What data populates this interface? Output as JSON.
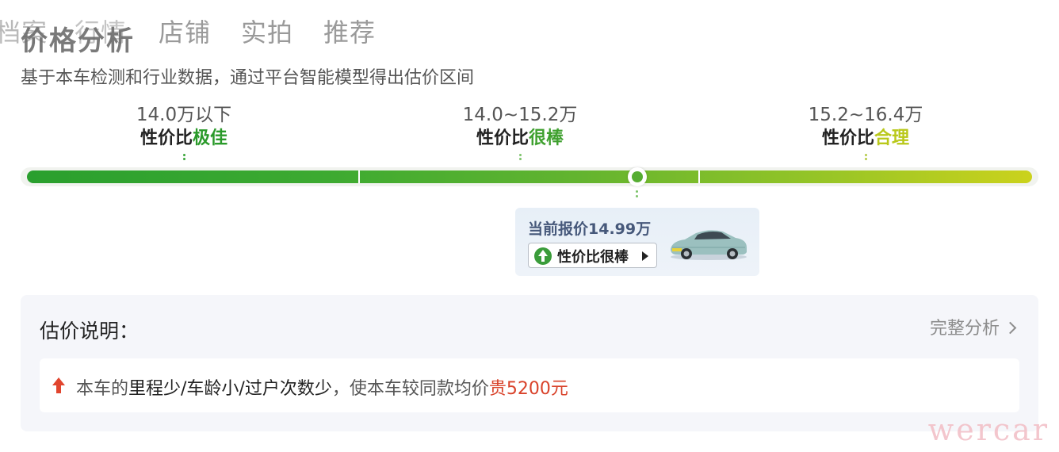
{
  "tabs": [
    "档案",
    "行情",
    "店铺",
    "实拍",
    "推荐"
  ],
  "section_title": "价格分析",
  "subtitle": "基于本车检测和行业数据，通过平台智能模型得出估价区间",
  "ranges": [
    {
      "price": "14.0万以下",
      "rating_prefix": "性价比",
      "rating_accent": "极佳"
    },
    {
      "price": "14.0~15.2万",
      "rating_prefix": "性价比",
      "rating_accent": "很棒"
    },
    {
      "price": "15.2~16.4万",
      "rating_prefix": "性价比",
      "rating_accent": "合理"
    }
  ],
  "current": {
    "label": "当前报价14.99万",
    "badge": "性价比很棒"
  },
  "explanation": {
    "title": "估价说明：",
    "link": "完整分析",
    "prefix": "本车的",
    "factors": "里程少/车龄小/过户次数少",
    "middle": "，使本车较同款均价",
    "delta": "贵5200元"
  },
  "watermark": "wercar",
  "colors": {
    "bar_start": "#2a9f2e",
    "bar_end": "#cbd21c",
    "good": "#3a9c3a",
    "expensive": "#d9432b"
  },
  "icons": [
    "up-arrow-icon",
    "play-triangle-icon",
    "chevron-right-icon",
    "car-image"
  ]
}
